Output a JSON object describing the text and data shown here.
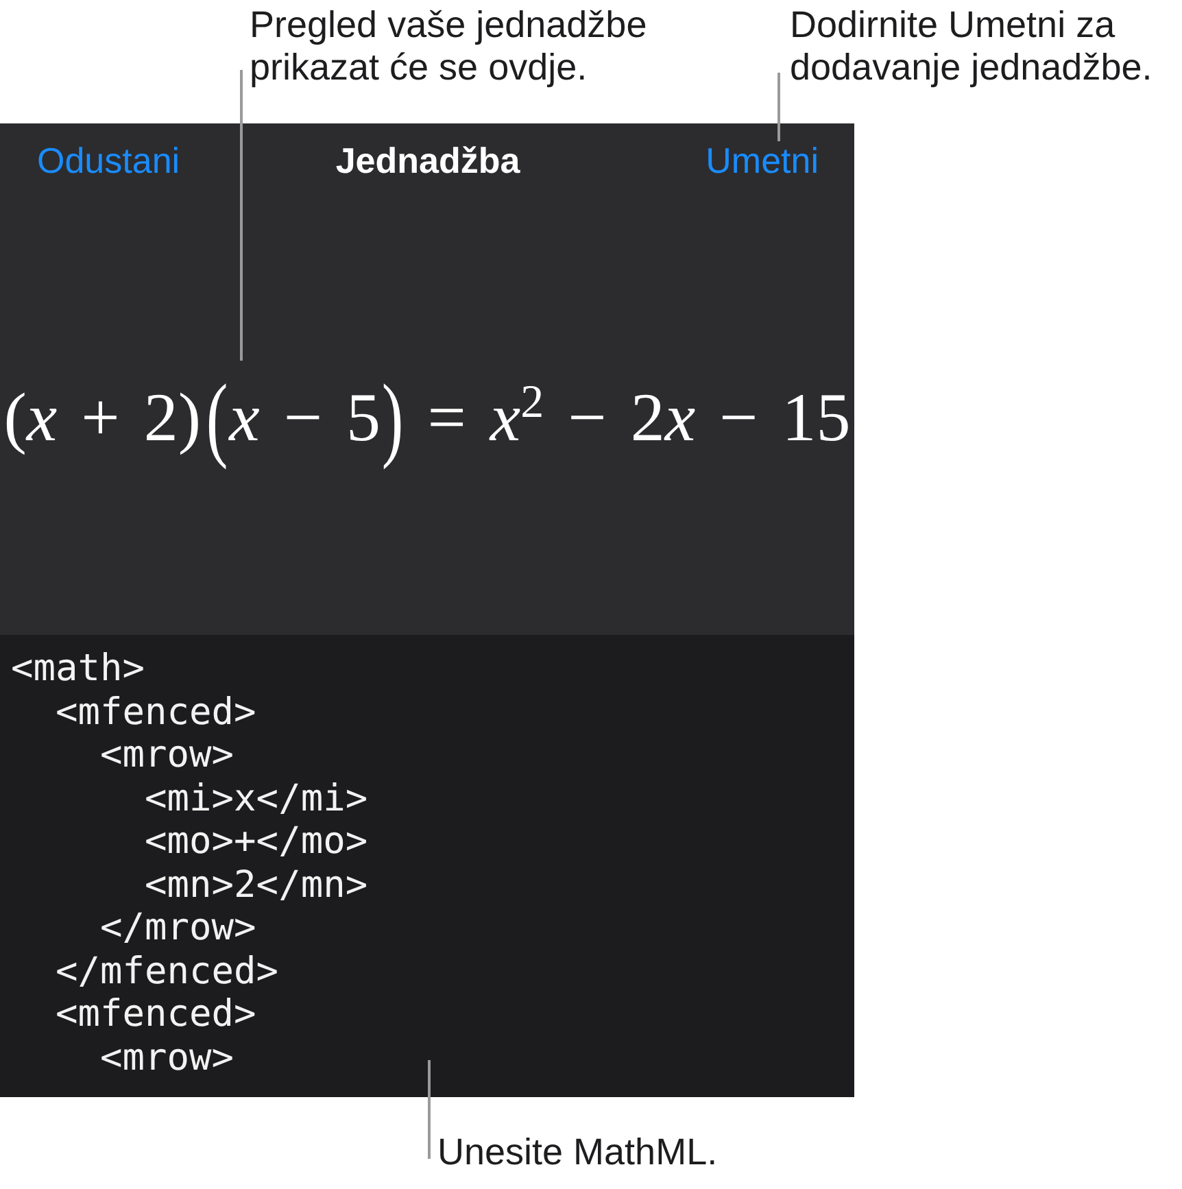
{
  "callouts_top": [
    {
      "text": "Pregled vaše jednadžbe prikazat će se ovdje."
    },
    {
      "text": "Dodirnite Umetni za dodavanje jednadžbe."
    }
  ],
  "dialog": {
    "cancel_button": "Odustani",
    "title": "Jednadžba",
    "insert_button": "Umetni",
    "preview": {
      "equation": [
        {
          "kind": "paren",
          "text": "("
        },
        {
          "kind": "var",
          "text": "x"
        },
        {
          "kind": "op",
          "text": "+"
        },
        {
          "kind": "num",
          "text": "2"
        },
        {
          "kind": "paren",
          "text": ")"
        },
        {
          "kind": "fence",
          "open": "(",
          "close": ")",
          "body": [
            {
              "kind": "var",
              "text": "x"
            },
            {
              "kind": "op",
              "text": "−"
            },
            {
              "kind": "num",
              "text": "5"
            }
          ]
        },
        {
          "kind": "op",
          "text": "="
        },
        {
          "kind": "var",
          "text": "x",
          "sup": "2"
        },
        {
          "kind": "op",
          "text": "−"
        },
        {
          "kind": "num",
          "text": "2"
        },
        {
          "kind": "var",
          "text": "x"
        },
        {
          "kind": "op",
          "text": "−"
        },
        {
          "kind": "num",
          "text": "15"
        }
      ]
    },
    "mathml_editor": {
      "lines": [
        {
          "text": "<math>",
          "children": [
            {
              "text": "<mfenced>",
              "children": [
                {
                  "text": "<mrow>",
                  "children": [
                    {
                      "text": "<mi>x</mi>"
                    },
                    {
                      "text": "<mo>+</mo>"
                    },
                    {
                      "text": "<mn>2</mn>"
                    }
                  ]
                },
                {
                  "text": "</mrow>"
                }
              ]
            },
            {
              "text": "</mfenced>"
            },
            {
              "text": "<mfenced>",
              "children": [
                {
                  "text": "<mrow>"
                }
              ]
            }
          ]
        }
      ]
    }
  },
  "callout_bottom": {
    "text": "Unesite MathML."
  }
}
